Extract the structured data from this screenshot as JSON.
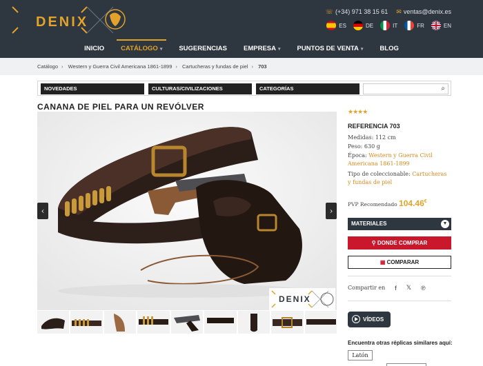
{
  "header": {
    "logo_text": "DENIX",
    "phone": "(+34) 971 38 15 61",
    "email": "ventas@denix.es",
    "languages": [
      {
        "code": "ES"
      },
      {
        "code": "DE"
      },
      {
        "code": "IT"
      },
      {
        "code": "FR"
      },
      {
        "code": "EN"
      }
    ],
    "accent_color": "#e3a32a",
    "bg_color": "#2e3640"
  },
  "nav": {
    "items": [
      {
        "label": "INICIO",
        "active": false
      },
      {
        "label": "CATÁLOGO",
        "active": true
      },
      {
        "label": "SUGERENCIAS",
        "active": false
      },
      {
        "label": "EMPRESA",
        "active": false
      },
      {
        "label": "PUNTOS DE VENTA",
        "active": false
      },
      {
        "label": "BLOG",
        "active": false
      }
    ]
  },
  "breadcrumb": [
    "Catálogo",
    "Western y Guerra Civil Americana 1861-1899",
    "Cartucheras y fundas de piel",
    "703"
  ],
  "filters": {
    "novedades": "NOVEDADES",
    "culturas": "CULTURAS/CIVILIZACIONES",
    "categorias": "CATEGORÍAS",
    "search_placeholder": ""
  },
  "product": {
    "title": "CANANA DE PIEL PARA UN REVÓLVER",
    "stars": "★★★★",
    "rating": 4,
    "reference": "REFERENCIA 703",
    "medidas_label": "Medidas:",
    "medidas": "112 cm",
    "peso_label": "Peso:",
    "peso": "630 g",
    "epoca_label": "Época:",
    "epoca": "Western y Guerra Civil Americana 1861-1899",
    "tipo_label": "Tipo de coleccionable:",
    "tipo": "Cartucheras y fundas de piel",
    "pvp_label": "PVP Recomendado",
    "price": "104.46",
    "currency": "€",
    "watermark_text": "DENIX"
  },
  "actions": {
    "materiales": "MATERIALES",
    "donde_comprar": "DONDE COMPRAR",
    "comparar": "COMPARAR",
    "compartir": "Compartir en",
    "videos": "VÍDEOS",
    "similares": "Encuentra otras réplicas similares aquí:",
    "tag1": "Latón"
  },
  "thumbnails_count": 9
}
